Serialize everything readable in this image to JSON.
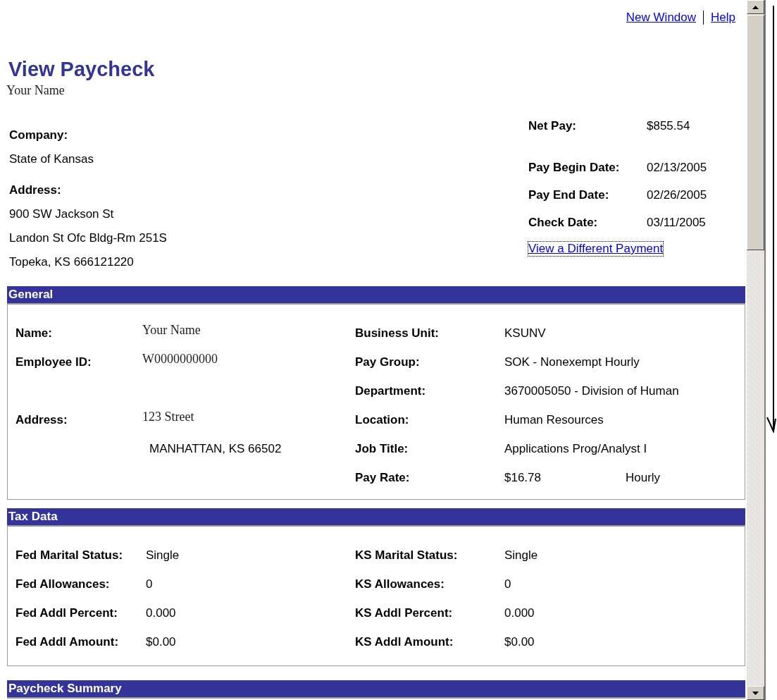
{
  "header_links": [
    {
      "label": "New Window"
    },
    {
      "label": "Help"
    }
  ],
  "title": "View Paycheck",
  "employee_name": "Your Name",
  "company": {
    "company_label": "Company:",
    "company_value": "State of Kansas",
    "address_label": "Address:",
    "address_lines": [
      "900 SW Jackson St",
      "Landon St Ofc Bldg-Rm 251S",
      "Topeka, KS 666121220"
    ]
  },
  "pay_info": [
    {
      "label": "Net Pay:",
      "value": "$855.54"
    },
    {
      "label": "Pay Begin Date:",
      "value": "02/13/2005"
    },
    {
      "label": "Pay End Date:",
      "value": "02/26/2005"
    },
    {
      "label": "Check Date:",
      "value": "03/11/2005"
    }
  ],
  "different_payment_link": "View a Different Payment",
  "general": {
    "title": "General",
    "left": [
      {
        "kind": "field",
        "label": "Name:",
        "value": "Your Name"
      },
      {
        "kind": "field",
        "label": "Employee ID:",
        "value": "W0000000000"
      },
      {
        "kind": "address",
        "label": "Address:",
        "lines": [
          "123 Street",
          "MANHATTAN, KS 66502"
        ]
      }
    ],
    "right": [
      {
        "label": "Business Unit:",
        "value": "KSUNV"
      },
      {
        "label": "Pay Group:",
        "value": "SOK - Nonexempt Hourly"
      },
      {
        "label": "Department:",
        "value": "3670005050 - Division of Human"
      },
      {
        "label": "Location:",
        "value": "Human Resources"
      },
      {
        "label": "Job Title:",
        "value": "Applications Prog/Analyst I"
      },
      {
        "label": "Pay Rate:",
        "value": "$16.78",
        "extra": "Hourly"
      }
    ]
  },
  "tax_data": {
    "title": "Tax Data",
    "left": [
      {
        "label": "Fed Marital Status:",
        "value": "Single"
      },
      {
        "label": "Fed Allowances:",
        "value": "0"
      },
      {
        "label": "Fed Addl Percent:",
        "value": "0.000"
      },
      {
        "label": "Fed Addl Amount:",
        "value": "$0.00"
      }
    ],
    "right": [
      {
        "label": "KS Marital Status:",
        "value": "Single"
      },
      {
        "label": "KS Allowances:",
        "value": "0"
      },
      {
        "label": "KS Addl Percent:",
        "value": "0.000"
      },
      {
        "label": "KS Addl Amount:",
        "value": "$0.00"
      }
    ]
  },
  "paycheck_summary": {
    "title": "Paycheck Summary"
  }
}
